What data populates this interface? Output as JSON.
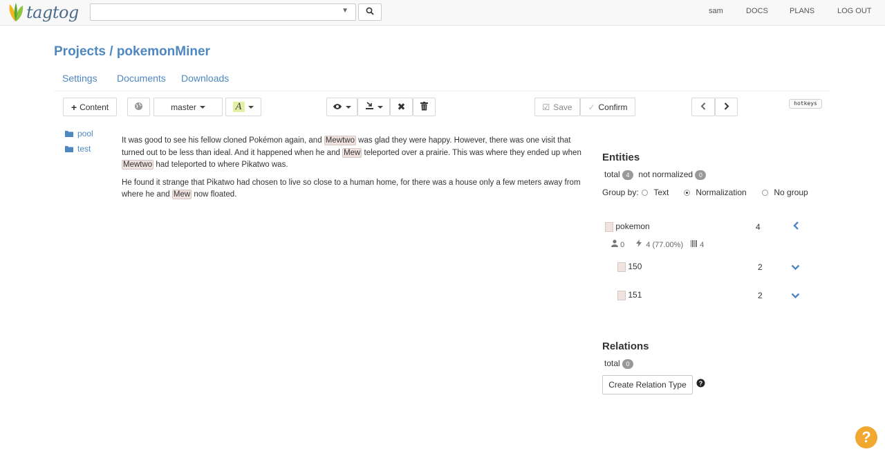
{
  "app": {
    "logo_text": "tagtog"
  },
  "topnav": {
    "user": "sam",
    "docs": "DOCS",
    "plans": "PLANS",
    "logout": "LOG OUT"
  },
  "search": {
    "placeholder": ""
  },
  "header": {
    "title": "Projects / pokemonMiner"
  },
  "subnav": {
    "settings": "Settings",
    "documents": "Documents",
    "downloads": "Downloads"
  },
  "toolbar": {
    "content_label": "Content",
    "branch_label": "master",
    "text_style_glyph": "A",
    "save_label": "Save",
    "confirm_label": "Confirm",
    "hotkeys_label": "hotkeys"
  },
  "folders": [
    {
      "name": "pool"
    },
    {
      "name": "test"
    }
  ],
  "document": {
    "p1": [
      "It was good to see his fellow cloned Pokémon again, and ",
      "Mewtwo",
      " was glad they were happy. However, there was one visit that turned out to be less than ideal. And it happened when he and ",
      "Mew",
      " teleported over a prairie. This was where they ended up when ",
      "Mewtwo",
      " had teleported to where Pikatwo was."
    ],
    "p2": [
      "He found it strange that Pikatwo had chosen to live so close to a human home, for there was a house only a few meters away from where he and ",
      "Mew",
      " now floated."
    ]
  },
  "entities": {
    "title": "Entities",
    "total_label": "total",
    "total_count": "4",
    "not_normalized_label": "not normalized",
    "not_normalized_count": "0",
    "group_by_label": "Group by:",
    "group_options": [
      "Text",
      "Normalization",
      "No group"
    ],
    "selected_group": "Normalization",
    "class": {
      "name": "pokemon",
      "count": "4",
      "users": "0",
      "auto": "4 (77.00%)",
      "norm": "4"
    },
    "groups": [
      {
        "name": "150",
        "count": "2"
      },
      {
        "name": "151",
        "count": "2"
      }
    ]
  },
  "relations": {
    "title": "Relations",
    "total_label": "total",
    "total_count": "0",
    "create_label": "Create Relation Type"
  },
  "colors": {
    "accent": "#4e87c1",
    "annotation_bg": "#f1e3e0",
    "help": "#f0a830"
  },
  "icons": [
    "leaf-logo-icon",
    "search-icon",
    "plus-icon",
    "globe-icon",
    "eye-icon",
    "import-icon",
    "close-icon",
    "trash-icon",
    "check-icon",
    "chevron-left-icon",
    "chevron-right-icon",
    "folder-icon",
    "user-icon",
    "bolt-icon",
    "barcode-icon",
    "chevron-down-icon",
    "question-icon"
  ]
}
